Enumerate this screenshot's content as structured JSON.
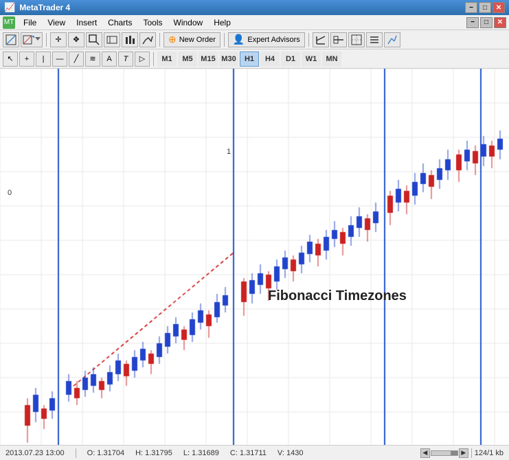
{
  "titleBar": {
    "title": "MetaTrader 4",
    "minimizeLabel": "−",
    "maximizeLabel": "□",
    "closeLabel": "✕"
  },
  "menuBar": {
    "appIconLabel": "MT",
    "items": [
      "File",
      "View",
      "Insert",
      "Charts",
      "Tools",
      "Window",
      "Help"
    ]
  },
  "toolbar1": {
    "newOrderLabel": "New Order",
    "expertAdvisorsLabel": "Expert Advisors"
  },
  "toolbar2": {
    "timeframes": [
      "M1",
      "M5",
      "M15",
      "M30",
      "H1",
      "H4",
      "D1",
      "W1",
      "MN"
    ],
    "activeTimeframe": "H1"
  },
  "chart": {
    "fibLabel": "Fibonacci Timezones",
    "fibNumbers": [
      "0",
      "1"
    ],
    "fibNumPositions": [
      {
        "label": "0",
        "left": "11",
        "top": "175"
      },
      {
        "label": "1",
        "left": "330",
        "top": "115"
      }
    ]
  },
  "statusBar": {
    "datetime": "2013.07.23 13:00",
    "open": "O: 1.31704",
    "high": "H: 1.31795",
    "low": "L: 1.31689",
    "close": "C: 1.31711",
    "volume": "V: 1430",
    "fileInfo": "124/1 kb"
  }
}
